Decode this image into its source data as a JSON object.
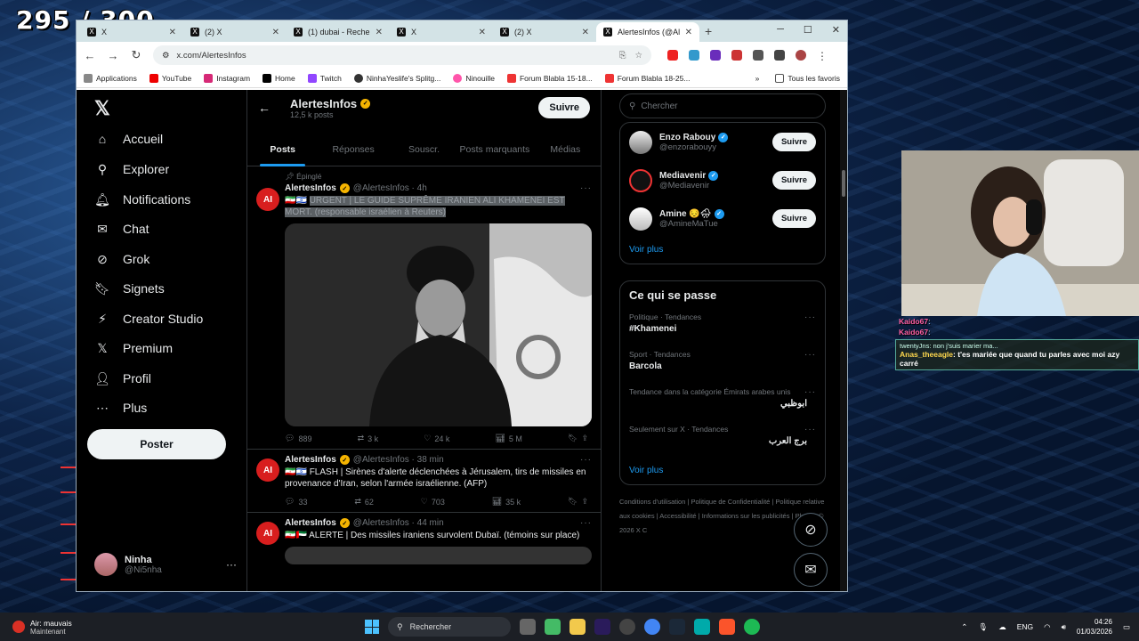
{
  "overlay": {
    "counter": "295 / 300"
  },
  "browser": {
    "tabs": [
      {
        "label": "X",
        "active": false
      },
      {
        "label": "(2) X",
        "active": false
      },
      {
        "label": "(1) dubai - Recherc",
        "active": false
      },
      {
        "label": "X",
        "active": false
      },
      {
        "label": "(2) X",
        "active": false
      },
      {
        "label": "AlertesInfos (@Ale",
        "active": true
      }
    ],
    "url": "x.com/AlertesInfos",
    "bookmarks": [
      "Applications",
      "YouTube",
      "Instagram",
      "Home",
      "Twitch",
      "NinhaYeslife's Splitg...",
      "Ninouille",
      "Forum Blabla 15-18...",
      "Forum Blabla 18-25..."
    ],
    "all_bookmarks": "Tous les favoris"
  },
  "nav": {
    "items": [
      "Accueil",
      "Explorer",
      "Notifications",
      "Chat",
      "Grok",
      "Signets",
      "Creator Studio",
      "Premium",
      "Profil",
      "Plus"
    ],
    "post_button": "Poster",
    "user_name": "Ninha",
    "user_handle": "@Ni5nha"
  },
  "profile": {
    "name": "AlertesInfos",
    "posts_count": "12,5 k posts",
    "follow": "Suivre",
    "tabs": [
      "Posts",
      "Réponses",
      "Souscr.",
      "Posts marquants",
      "Médias"
    ]
  },
  "tweets": [
    {
      "pinned": "Épinglé",
      "name": "AlertesInfos",
      "handle": "@AlertesInfos · 4h",
      "flags": "🇮🇷🇮🇱",
      "text": "URGENT | LE GUIDE SUPRÊME IRANIEN ALI KHAMENEI EST MORT. (responsable israélien à Reuters)",
      "replies": "889",
      "reposts": "3 k",
      "likes": "24 k",
      "views": "5 M"
    },
    {
      "name": "AlertesInfos",
      "handle": "@AlertesInfos · 38 min",
      "flags": "🇮🇷🇮🇱",
      "text": "FLASH | Sirènes d'alerte déclenchées à Jérusalem, tirs de missiles en provenance d'Iran, selon l'armée israélienne. (AFP)",
      "replies": "33",
      "reposts": "62",
      "likes": "703",
      "views": "35 k"
    },
    {
      "name": "AlertesInfos",
      "handle": "@AlertesInfos · 44 min",
      "flags": "🇮🇷🇦🇪",
      "text": "ALERTE | Des missiles iraniens survolent Dubaï. (témoins sur place)"
    }
  ],
  "sidebar": {
    "search_placeholder": "Chercher",
    "who_to_follow": [
      {
        "name": "Enzo Rabouy",
        "handle": "@enzorabouyy",
        "btn": "Suivre"
      },
      {
        "name": "Mediavenir",
        "handle": "@Mediavenir",
        "btn": "Suivre"
      },
      {
        "name": "Amine 😔🌧",
        "handle": "@AmineMaTue",
        "btn": "Suivre"
      }
    ],
    "see_more": "Voir plus",
    "trends_title": "Ce qui se passe",
    "trends": [
      {
        "context": "Politique · Tendances",
        "topic": "#Khamenei"
      },
      {
        "context": "Sport · Tendances",
        "topic": "Barcola"
      },
      {
        "context": "Tendance dans la catégorie Émirats arabes unis",
        "topic": "ابوظبي"
      },
      {
        "context": "Seulement sur X · Tendances",
        "topic": "برج العرب"
      }
    ],
    "footer": "Conditions d'utilisation | Politique de Confidentialité | Politique relative aux cookies | Accessibilité | Informations sur les publicités | Plus ··· © 2026 X C"
  },
  "chat": {
    "lines": [
      {
        "user": "Kaido67",
        "text": ":"
      },
      {
        "user": "Kaido67",
        "text": ":"
      }
    ],
    "reply_context": "twentyJns: non j'suis marier ma...",
    "reply_user": "Anas_theeagle",
    "reply_text": ": t'es mariée que quand tu parles avec moi azy carré"
  },
  "taskbar": {
    "weather_title": "Air: mauvais",
    "weather_sub": "Maintenant",
    "search": "Rechercher",
    "lang": "ENG",
    "time": "04:26",
    "date": "01/03/2026"
  }
}
